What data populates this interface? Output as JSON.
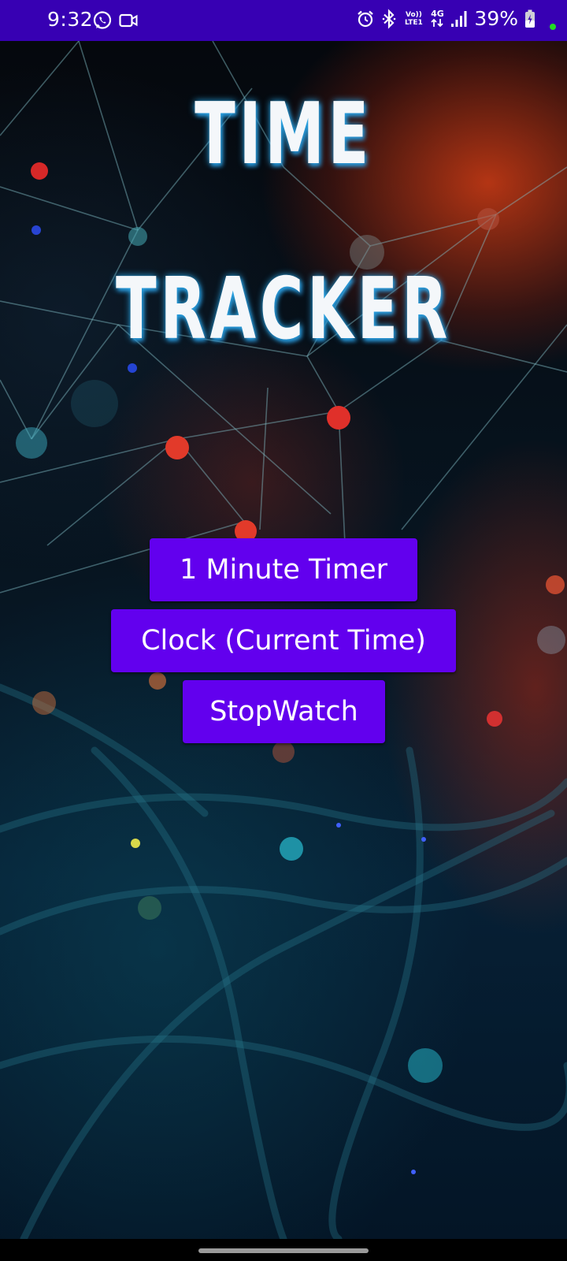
{
  "status_bar": {
    "time": "9:32",
    "battery_percent": "39%",
    "network_label_top": "Vo)) LTE1",
    "network_type": "4G",
    "left_icons": [
      "whatsapp-icon",
      "video-camera-icon"
    ],
    "right_icons": [
      "alarm-icon",
      "bluetooth-icon",
      "volte-icon",
      "4g-data-icon",
      "signal-strength-icon",
      "battery-icon"
    ],
    "background_color": "#3700b3"
  },
  "main": {
    "title_line_1": "TIME",
    "title_line_2": "TRACKER",
    "buttons": {
      "timer": "1 Minute Timer",
      "clock": "Clock (Current Time)",
      "stopwatch": "StopWatch"
    },
    "button_color": "#6200ee"
  },
  "nav_bar": {
    "handle": "gesture-navigation-handle"
  }
}
